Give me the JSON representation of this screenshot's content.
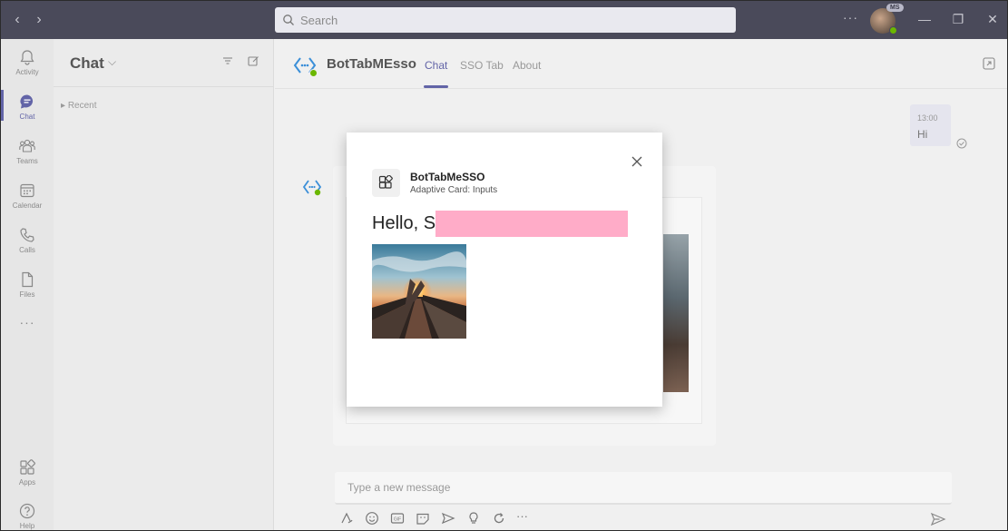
{
  "titlebar": {
    "search_placeholder": "Search",
    "more_label": "···",
    "avatar_badge": "MS"
  },
  "rail": {
    "items": [
      {
        "label": "Activity",
        "icon": "bell-icon"
      },
      {
        "label": "Chat",
        "icon": "chat-icon"
      },
      {
        "label": "Teams",
        "icon": "teams-icon"
      },
      {
        "label": "Calendar",
        "icon": "calendar-icon"
      },
      {
        "label": "Calls",
        "icon": "phone-icon"
      },
      {
        "label": "Files",
        "icon": "file-icon"
      },
      {
        "label": "Apps",
        "icon": "apps-icon"
      },
      {
        "label": "Help",
        "icon": "help-icon"
      }
    ],
    "more_label": "···"
  },
  "chatlist": {
    "title": "Chat",
    "recent_label": "Recent"
  },
  "main": {
    "bot_name": "BotTabMEsso",
    "tabs": [
      {
        "label": "Chat",
        "active": true
      },
      {
        "label": "SSO Tab",
        "active": false
      },
      {
        "label": "About",
        "active": false
      }
    ],
    "message": {
      "time": "13:00",
      "text": "Hi"
    },
    "compose_placeholder": "Type a new message"
  },
  "dialog": {
    "app_name": "BotTabMeSSO",
    "subtitle": "Adaptive Card: Inputs",
    "greeting": "Hello, S"
  },
  "colors": {
    "accent": "#6264a7",
    "presence": "#6bb700",
    "redaction": "#ffacc8",
    "titlebar": "#4a4a5a"
  }
}
